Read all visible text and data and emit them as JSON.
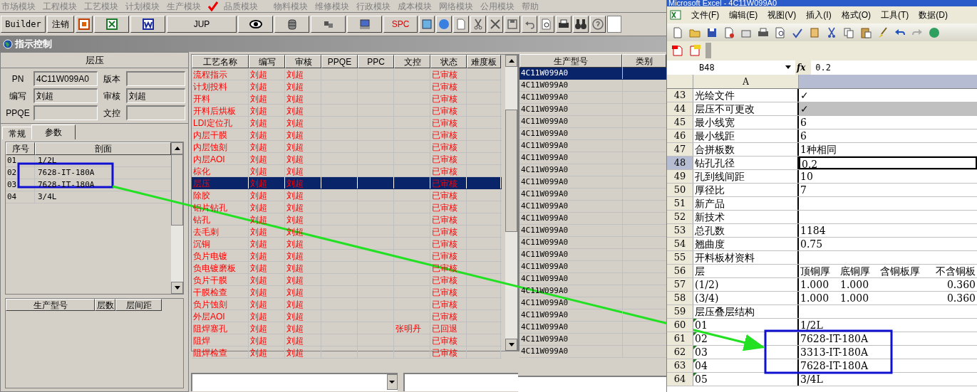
{
  "menu": {
    "items": [
      {
        "label": "市场模块",
        "checked": false
      },
      {
        "label": "工程模块",
        "checked": false
      },
      {
        "label": "工艺模块",
        "checked": false
      },
      {
        "label": "计划模块",
        "checked": false
      },
      {
        "label": "生产模块",
        "checked": false
      },
      {
        "label": "品质模块",
        "checked": true
      },
      {
        "label": "物料模块",
        "checked": false
      },
      {
        "label": "维修模块",
        "checked": false
      },
      {
        "label": "行政模块",
        "checked": false
      },
      {
        "label": "成本模块",
        "checked": false
      },
      {
        "label": "网络模块",
        "checked": false
      },
      {
        "label": "公用模块",
        "checked": false
      },
      {
        "label": "帮助",
        "checked": false
      }
    ]
  },
  "toolbar": {
    "buttons": [
      "Builder",
      "注销",
      "JUP",
      "SPC"
    ]
  },
  "window": {
    "title": "指示控制"
  },
  "left_panel": {
    "title": "层压",
    "fields": [
      {
        "label": "PN",
        "value": "4C11W099A0"
      },
      {
        "label": "版本"
      },
      {
        "label": "编写",
        "value": "刘超"
      },
      {
        "label": "审核",
        "value": "刘超"
      },
      {
        "label": "PPQE"
      },
      {
        "label": "文控"
      }
    ],
    "tabs": [
      {
        "label": "常规",
        "selected": false
      },
      {
        "label": "参数",
        "selected": true
      }
    ],
    "layers": {
      "columns": [
        "序号",
        "剖面"
      ],
      "rows": [
        {
          "no": "01",
          "section": "1/2L"
        },
        {
          "no": "02",
          "section": "7628-IT-180A"
        },
        {
          "no": "03",
          "section": "7628-IT-180A"
        },
        {
          "no": "04",
          "section": "3/4L"
        }
      ]
    },
    "models": {
      "columns": [
        "生产型号",
        "层数",
        "层间距"
      ]
    }
  },
  "process_table": {
    "columns": [
      "工艺名称",
      "编写",
      "审核",
      "PPQE",
      "PPC",
      "文控",
      "状态",
      "难度板"
    ],
    "rows": [
      {
        "process": "流程指示",
        "writer": "刘超",
        "reviewer": "刘超",
        "status": "已审核",
        "selected": false
      },
      {
        "process": "计划投料",
        "writer": "刘超",
        "reviewer": "刘超",
        "status": "已审核",
        "selected": false
      },
      {
        "process": "开料",
        "writer": "刘超",
        "reviewer": "刘超",
        "status": "已审核",
        "selected": false
      },
      {
        "process": "开料后烘板",
        "writer": "刘超",
        "reviewer": "刘超",
        "status": "已审核",
        "selected": false
      },
      {
        "process": "LDI定位孔",
        "writer": "刘超",
        "reviewer": "刘超",
        "status": "已审核",
        "selected": false
      },
      {
        "process": "内层干膜",
        "writer": "刘超",
        "reviewer": "刘超",
        "status": "已审核",
        "selected": false
      },
      {
        "process": "内层蚀刻",
        "writer": "刘超",
        "reviewer": "刘超",
        "status": "已审核",
        "selected": false
      },
      {
        "process": "内层AOI",
        "writer": "刘超",
        "reviewer": "刘超",
        "status": "已审核",
        "selected": false
      },
      {
        "process": "棕化",
        "writer": "刘超",
        "reviewer": "刘超",
        "status": "已审核",
        "selected": false
      },
      {
        "process": "层压",
        "writer": "刘超",
        "reviewer": "刘超",
        "status": "已审核",
        "selected": true
      },
      {
        "process": "除胶",
        "writer": "刘超",
        "reviewer": "刘超",
        "status": "已审核",
        "selected": false
      },
      {
        "process": "铝片钻孔",
        "writer": "刘超",
        "reviewer": "刘超",
        "status": "已审核",
        "selected": false
      },
      {
        "process": "钻孔",
        "writer": "刘超",
        "reviewer": "刘超",
        "status": "已审核",
        "selected": false
      },
      {
        "process": "去毛刺",
        "writer": "刘超",
        "reviewer": "刘超",
        "status": "已审核",
        "selected": false
      },
      {
        "process": "沉铜",
        "writer": "刘超",
        "reviewer": "刘超",
        "status": "已审核",
        "selected": false
      },
      {
        "process": "负片电镀",
        "writer": "刘超",
        "reviewer": "刘超",
        "status": "已审核",
        "selected": false
      },
      {
        "process": "负电镀磨板",
        "writer": "刘超",
        "reviewer": "刘超",
        "status": "已审核",
        "selected": false
      },
      {
        "process": "负片干膜",
        "writer": "刘超",
        "reviewer": "刘超",
        "status": "已审核",
        "selected": false
      },
      {
        "process": "干膜检查",
        "writer": "刘超",
        "reviewer": "刘超",
        "status": "已审核",
        "selected": false
      },
      {
        "process": "负片蚀刻",
        "writer": "刘超",
        "reviewer": "刘超",
        "status": "已审核",
        "selected": false
      },
      {
        "process": "外层AOI",
        "writer": "刘超",
        "reviewer": "刘超",
        "status": "已审核",
        "selected": false
      },
      {
        "process": "阻焊塞孔",
        "writer": "刘超",
        "reviewer": "刘超",
        "doc_control": "张明丹",
        "status": "已回退",
        "selected": false
      },
      {
        "process": "阻焊",
        "writer": "刘超",
        "reviewer": "刘超",
        "status": "已审核",
        "selected": false
      },
      {
        "process": "阻焊检查",
        "writer": "刘超",
        "reviewer": "刘超",
        "status": "已审核",
        "selected": false
      }
    ]
  },
  "model_table": {
    "columns": [
      "生产型号",
      "类别"
    ],
    "rows": [
      {
        "model": "4C11W099A0",
        "selected": true
      },
      {
        "model": "4C11W099A0",
        "selected": false
      },
      {
        "model": "4C11W099A0",
        "selected": false
      },
      {
        "model": "4C11W099A0",
        "selected": false
      },
      {
        "model": "4C11W099A0",
        "selected": false
      },
      {
        "model": "4C11W099A0",
        "selected": false
      },
      {
        "model": "4C11W099A0",
        "selected": false
      },
      {
        "model": "4C11W099A0",
        "selected": false
      },
      {
        "model": "4C11W099A0",
        "selected": false
      },
      {
        "model": "4C11W099A0",
        "selected": false
      },
      {
        "model": "4C11W099A0",
        "selected": false
      },
      {
        "model": "4C11W099A0",
        "selected": false
      },
      {
        "model": "4C11W099A0",
        "selected": false
      },
      {
        "model": "4C11W099A0",
        "selected": false
      },
      {
        "model": "4C11W099A0",
        "selected": false
      },
      {
        "model": "4C11W099A0",
        "selected": false
      },
      {
        "model": "4C11W099A0",
        "selected": false
      },
      {
        "model": "4C11W099A0",
        "selected": false
      },
      {
        "model": "4C11W099A0",
        "selected": false
      },
      {
        "model": "4C11W099A0",
        "selected": false
      },
      {
        "model": "4C11W099A0",
        "selected": false
      },
      {
        "model": "4C11W099A0",
        "selected": false
      },
      {
        "model": "4C11W099A0",
        "selected": false
      },
      {
        "model": "4C11W099A0",
        "selected": false
      }
    ]
  },
  "excel": {
    "title": "Microsoft Excel - 4C11W099A0",
    "menu": [
      "文件(F)",
      "编辑(E)",
      "视图(V)",
      "插入(I)",
      "格式(O)",
      "工具(T)",
      "数据(D)"
    ],
    "name_box": "B48",
    "fx_label": "fx",
    "formula": "0.2",
    "column_a": "A",
    "rows": [
      {
        "row": "43",
        "a": "光绘文件",
        "b": "✓",
        "selected": false,
        "shaded": false,
        "flagged": false
      },
      {
        "row": "44",
        "a": "层压不可更改",
        "b": "✓",
        "selected": false,
        "shaded": true,
        "flagged": false
      },
      {
        "row": "45",
        "a": "最小线宽",
        "b": "6",
        "selected": false,
        "shaded": false,
        "flagged": false
      },
      {
        "row": "46",
        "a": "最小线距",
        "b": "6",
        "selected": false,
        "shaded": false,
        "flagged": false
      },
      {
        "row": "47",
        "a": "合拼板数",
        "b": "1种相同",
        "selected": false,
        "shaded": false,
        "flagged": false
      },
      {
        "row": "48",
        "a": "钻孔孔径",
        "b": "0.2",
        "selected": true,
        "shaded": false,
        "flagged": false
      },
      {
        "row": "49",
        "a": "孔到线间距",
        "b": "10",
        "selected": false,
        "shaded": false,
        "flagged": false
      },
      {
        "row": "50",
        "a": "厚径比",
        "b": "7",
        "selected": false,
        "shaded": false,
        "flagged": false
      },
      {
        "row": "51",
        "a": "新产品",
        "selected": false,
        "shaded": false,
        "flagged": false
      },
      {
        "row": "52",
        "a": "新技术",
        "selected": false,
        "shaded": false,
        "flagged": false
      },
      {
        "row": "53",
        "a": "总孔数",
        "b": "1184",
        "selected": false,
        "shaded": false,
        "flagged": false
      },
      {
        "row": "54",
        "a": "翘曲度",
        "b": "0.75",
        "selected": false,
        "shaded": false,
        "flagged": false
      },
      {
        "row": "55",
        "a": "开料板材资料",
        "selected": false,
        "shaded": false,
        "flagged": false
      },
      {
        "row": "56",
        "a": "层",
        "b": "顶铜厚",
        "c": "底铜厚",
        "d": "含铜板厚",
        "e": "不含铜板",
        "selected": false,
        "shaded": false,
        "flagged": false
      },
      {
        "row": "57",
        "a": "(1/2)",
        "b": "1.000",
        "c": "1.000",
        "e": "0.360",
        "selected": false,
        "shaded": false,
        "flagged": false
      },
      {
        "row": "58",
        "a": "(3/4)",
        "b": "1.000",
        "c": "1.000",
        "e": "0.360",
        "selected": false,
        "shaded": false,
        "flagged": false
      },
      {
        "row": "59",
        "a": "层压叠层结构",
        "selected": false,
        "shaded": false,
        "flagged": false
      },
      {
        "row": "60",
        "a": "01",
        "b": "1/2L",
        "selected": false,
        "shaded": false,
        "flagged": true
      },
      {
        "row": "61",
        "a": "02",
        "b": "7628-IT-180A",
        "selected": false,
        "shaded": false,
        "flagged": true
      },
      {
        "row": "62",
        "a": "03",
        "b": "3313-IT-180A",
        "selected": false,
        "shaded": false,
        "flagged": true
      },
      {
        "row": "63",
        "a": "04",
        "b": "7628-IT-180A",
        "selected": false,
        "shaded": false,
        "flagged": true
      },
      {
        "row": "64",
        "a": "05",
        "b": "3/4L",
        "selected": false,
        "shaded": false,
        "flagged": true
      }
    ]
  }
}
